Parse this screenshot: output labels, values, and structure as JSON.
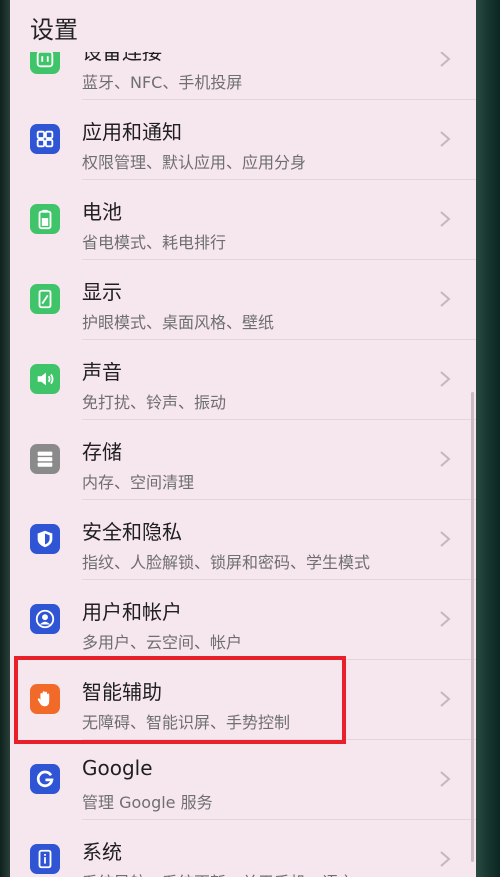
{
  "header": {
    "title": "设置"
  },
  "settings": [
    {
      "title": "设备连接",
      "subtitle": "蓝牙、NFC、手机投屏",
      "icon": "device-connect-icon",
      "color": "#3fc46a"
    },
    {
      "title": "应用和通知",
      "subtitle": "权限管理、默认应用、应用分身",
      "icon": "apps-grid-icon",
      "color": "#2f55d4"
    },
    {
      "title": "电池",
      "subtitle": "省电模式、耗电排行",
      "icon": "battery-icon",
      "color": "#3fc46a"
    },
    {
      "title": "显示",
      "subtitle": "护眼模式、桌面风格、壁纸",
      "icon": "display-icon",
      "color": "#3fc46a"
    },
    {
      "title": "声音",
      "subtitle": "免打扰、铃声、振动",
      "icon": "speaker-icon",
      "color": "#3fc46a"
    },
    {
      "title": "存储",
      "subtitle": "内存、空间清理",
      "icon": "storage-icon",
      "color": "#8a8a8a"
    },
    {
      "title": "安全和隐私",
      "subtitle": "指纹、人脸解锁、锁屏和密码、学生模式",
      "icon": "shield-icon",
      "color": "#2f55d4"
    },
    {
      "title": "用户和帐户",
      "subtitle": "多用户、云空间、帐户",
      "icon": "user-icon",
      "color": "#2f55d4"
    },
    {
      "title": "智能辅助",
      "subtitle": "无障碍、智能识屏、手势控制",
      "icon": "hand-icon",
      "color": "#f26a2a"
    },
    {
      "title": "Google",
      "subtitle": "管理 Google 服务",
      "icon": "google-g-icon",
      "color": "#2f55d4"
    },
    {
      "title": "系统",
      "subtitle": "系统导航、系统更新、关于手机、语言",
      "icon": "system-info-icon",
      "color": "#2f55d4"
    }
  ],
  "colors": {
    "background": "#f6e6ee",
    "highlight": "#e8202a"
  }
}
